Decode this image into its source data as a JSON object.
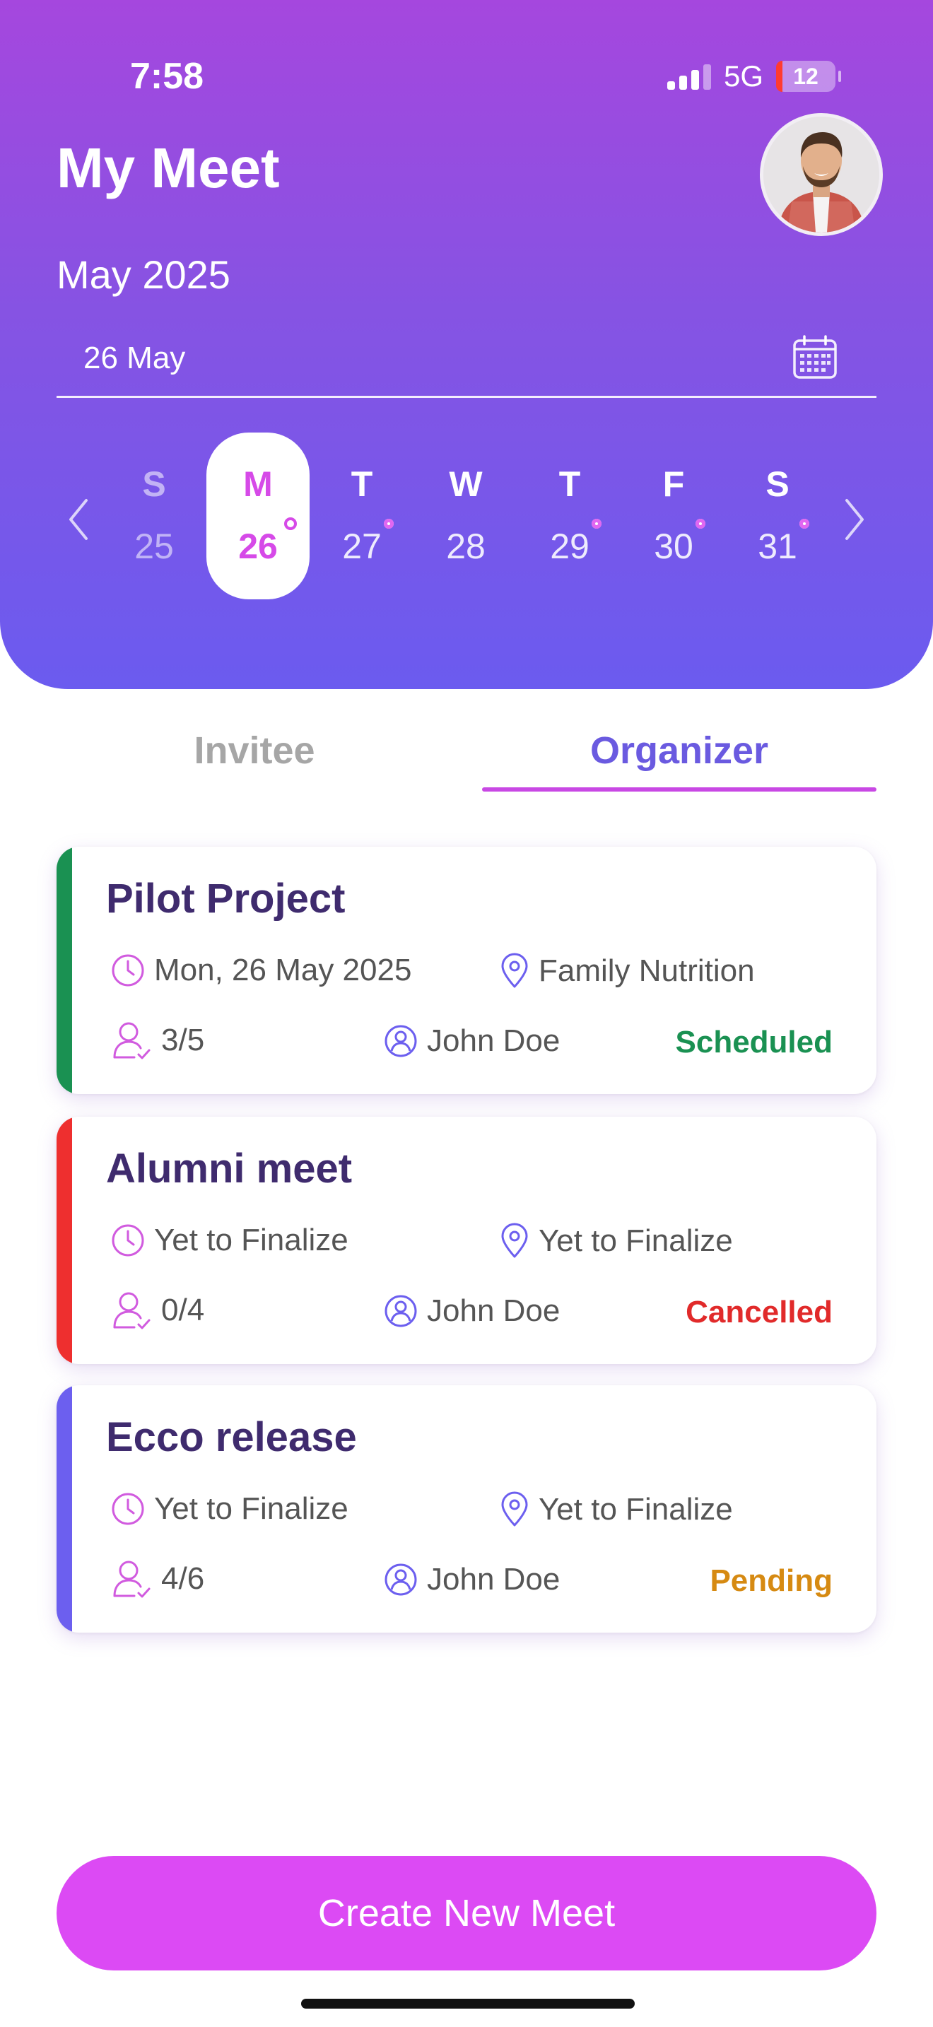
{
  "status_bar": {
    "time": "7:58",
    "network": "5G",
    "battery": "12"
  },
  "header": {
    "title": "My Meet",
    "month": "May 2025",
    "date_field": {
      "value": "26 May"
    }
  },
  "week": {
    "days": [
      {
        "name": "S",
        "number": "25",
        "has_event": false,
        "selected": false,
        "dim": true
      },
      {
        "name": "M",
        "number": "26",
        "has_event": true,
        "selected": true,
        "dim": false
      },
      {
        "name": "T",
        "number": "27",
        "has_event": true,
        "selected": false,
        "dim": false
      },
      {
        "name": "W",
        "number": "28",
        "has_event": false,
        "selected": false,
        "dim": false
      },
      {
        "name": "T",
        "number": "29",
        "has_event": true,
        "selected": false,
        "dim": false
      },
      {
        "name": "F",
        "number": "30",
        "has_event": true,
        "selected": false,
        "dim": false
      },
      {
        "name": "S",
        "number": "31",
        "has_event": true,
        "selected": false,
        "dim": false
      }
    ]
  },
  "tabs": {
    "invitee": "Invitee",
    "organizer": "Organizer",
    "active": "organizer"
  },
  "meetings": [
    {
      "title": "Pilot Project",
      "date": "Mon, 26 May 2025",
      "location": "Family Nutrition",
      "attendees": "3/5",
      "organizer": "John Doe",
      "status": "Scheduled",
      "accent": "#1a9152",
      "status_color": "#1a9152"
    },
    {
      "title": "Alumni meet",
      "date": "Yet to Finalize",
      "location": "Yet to Finalize",
      "attendees": "0/4",
      "organizer": "John Doe",
      "status": "Cancelled",
      "accent": "#ee2f2f",
      "status_color": "#e12a2a"
    },
    {
      "title": "Ecco release",
      "date": "Yet to Finalize",
      "location": "Yet to Finalize",
      "attendees": "4/6",
      "organizer": "John Doe",
      "status": "Pending",
      "accent": "#6c5fef",
      "status_color": "#d68a12"
    }
  ],
  "create_button": {
    "label": "Create New Meet"
  },
  "colors": {
    "header_top": "#a547de",
    "header_bottom": "#6b5bef",
    "accent_pink": "#dc4af4",
    "organizer_tab": "#6a5ae0",
    "card_title": "#3f2b6e"
  }
}
